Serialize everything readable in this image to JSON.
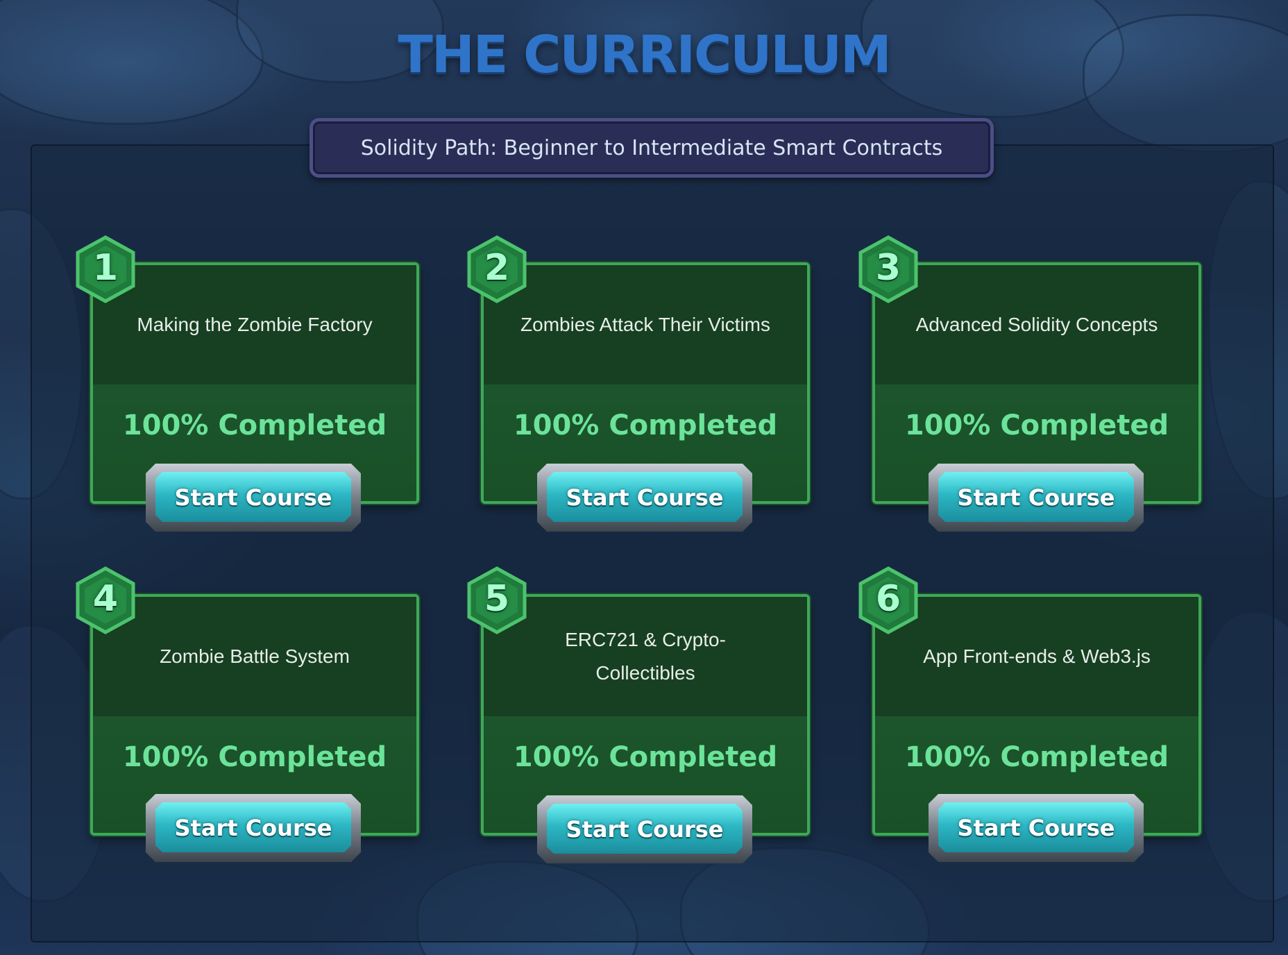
{
  "page": {
    "title": "THE CURRICULUM",
    "subtitle": "Solidity Path: Beginner to Intermediate Smart Contracts"
  },
  "courses": [
    {
      "number": "1",
      "title": "Making the Zombie Factory",
      "progress": "100% Completed",
      "button_label": "Start Course"
    },
    {
      "number": "2",
      "title": "Zombies Attack Their Victims",
      "progress": "100% Completed",
      "button_label": "Start Course"
    },
    {
      "number": "3",
      "title": "Advanced Solidity Concepts",
      "progress": "100% Completed",
      "button_label": "Start Course"
    },
    {
      "number": "4",
      "title": "Zombie Battle System",
      "progress": "100% Completed",
      "button_label": "Start Course"
    },
    {
      "number": "5",
      "title": "ERC721 & Crypto-Collectibles",
      "progress": "100% Completed",
      "button_label": "Start Course"
    },
    {
      "number": "6",
      "title": "App Front-ends & Web3.js",
      "progress": "100% Completed",
      "button_label": "Start Course"
    }
  ],
  "colors": {
    "title": "#2f74c8",
    "card_border": "#3ea85a",
    "progress_text": "#6ce39a",
    "button_face": "#2cb7c4"
  }
}
